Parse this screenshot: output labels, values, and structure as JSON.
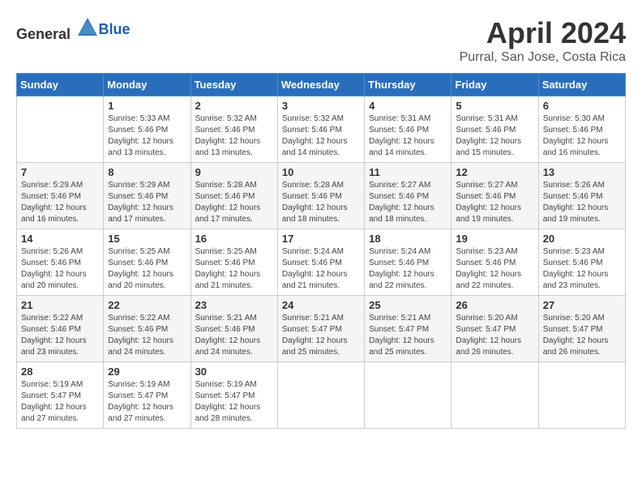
{
  "header": {
    "logo_general": "General",
    "logo_blue": "Blue",
    "title": "April 2024",
    "location": "Purral, San Jose, Costa Rica"
  },
  "calendar": {
    "days_of_week": [
      "Sunday",
      "Monday",
      "Tuesday",
      "Wednesday",
      "Thursday",
      "Friday",
      "Saturday"
    ],
    "weeks": [
      [
        {
          "day": "",
          "sunrise": "",
          "sunset": "",
          "daylight": ""
        },
        {
          "day": "1",
          "sunrise": "Sunrise: 5:33 AM",
          "sunset": "Sunset: 5:46 PM",
          "daylight": "Daylight: 12 hours and 13 minutes."
        },
        {
          "day": "2",
          "sunrise": "Sunrise: 5:32 AM",
          "sunset": "Sunset: 5:46 PM",
          "daylight": "Daylight: 12 hours and 13 minutes."
        },
        {
          "day": "3",
          "sunrise": "Sunrise: 5:32 AM",
          "sunset": "Sunset: 5:46 PM",
          "daylight": "Daylight: 12 hours and 14 minutes."
        },
        {
          "day": "4",
          "sunrise": "Sunrise: 5:31 AM",
          "sunset": "Sunset: 5:46 PM",
          "daylight": "Daylight: 12 hours and 14 minutes."
        },
        {
          "day": "5",
          "sunrise": "Sunrise: 5:31 AM",
          "sunset": "Sunset: 5:46 PM",
          "daylight": "Daylight: 12 hours and 15 minutes."
        },
        {
          "day": "6",
          "sunrise": "Sunrise: 5:30 AM",
          "sunset": "Sunset: 5:46 PM",
          "daylight": "Daylight: 12 hours and 16 minutes."
        }
      ],
      [
        {
          "day": "7",
          "sunrise": "Sunrise: 5:29 AM",
          "sunset": "Sunset: 5:46 PM",
          "daylight": "Daylight: 12 hours and 16 minutes."
        },
        {
          "day": "8",
          "sunrise": "Sunrise: 5:29 AM",
          "sunset": "Sunset: 5:46 PM",
          "daylight": "Daylight: 12 hours and 17 minutes."
        },
        {
          "day": "9",
          "sunrise": "Sunrise: 5:28 AM",
          "sunset": "Sunset: 5:46 PM",
          "daylight": "Daylight: 12 hours and 17 minutes."
        },
        {
          "day": "10",
          "sunrise": "Sunrise: 5:28 AM",
          "sunset": "Sunset: 5:46 PM",
          "daylight": "Daylight: 12 hours and 18 minutes."
        },
        {
          "day": "11",
          "sunrise": "Sunrise: 5:27 AM",
          "sunset": "Sunset: 5:46 PM",
          "daylight": "Daylight: 12 hours and 18 minutes."
        },
        {
          "day": "12",
          "sunrise": "Sunrise: 5:27 AM",
          "sunset": "Sunset: 5:46 PM",
          "daylight": "Daylight: 12 hours and 19 minutes."
        },
        {
          "day": "13",
          "sunrise": "Sunrise: 5:26 AM",
          "sunset": "Sunset: 5:46 PM",
          "daylight": "Daylight: 12 hours and 19 minutes."
        }
      ],
      [
        {
          "day": "14",
          "sunrise": "Sunrise: 5:26 AM",
          "sunset": "Sunset: 5:46 PM",
          "daylight": "Daylight: 12 hours and 20 minutes."
        },
        {
          "day": "15",
          "sunrise": "Sunrise: 5:25 AM",
          "sunset": "Sunset: 5:46 PM",
          "daylight": "Daylight: 12 hours and 20 minutes."
        },
        {
          "day": "16",
          "sunrise": "Sunrise: 5:25 AM",
          "sunset": "Sunset: 5:46 PM",
          "daylight": "Daylight: 12 hours and 21 minutes."
        },
        {
          "day": "17",
          "sunrise": "Sunrise: 5:24 AM",
          "sunset": "Sunset: 5:46 PM",
          "daylight": "Daylight: 12 hours and 21 minutes."
        },
        {
          "day": "18",
          "sunrise": "Sunrise: 5:24 AM",
          "sunset": "Sunset: 5:46 PM",
          "daylight": "Daylight: 12 hours and 22 minutes."
        },
        {
          "day": "19",
          "sunrise": "Sunrise: 5:23 AM",
          "sunset": "Sunset: 5:46 PM",
          "daylight": "Daylight: 12 hours and 22 minutes."
        },
        {
          "day": "20",
          "sunrise": "Sunrise: 5:23 AM",
          "sunset": "Sunset: 5:46 PM",
          "daylight": "Daylight: 12 hours and 23 minutes."
        }
      ],
      [
        {
          "day": "21",
          "sunrise": "Sunrise: 5:22 AM",
          "sunset": "Sunset: 5:46 PM",
          "daylight": "Daylight: 12 hours and 23 minutes."
        },
        {
          "day": "22",
          "sunrise": "Sunrise: 5:22 AM",
          "sunset": "Sunset: 5:46 PM",
          "daylight": "Daylight: 12 hours and 24 minutes."
        },
        {
          "day": "23",
          "sunrise": "Sunrise: 5:21 AM",
          "sunset": "Sunset: 5:46 PM",
          "daylight": "Daylight: 12 hours and 24 minutes."
        },
        {
          "day": "24",
          "sunrise": "Sunrise: 5:21 AM",
          "sunset": "Sunset: 5:47 PM",
          "daylight": "Daylight: 12 hours and 25 minutes."
        },
        {
          "day": "25",
          "sunrise": "Sunrise: 5:21 AM",
          "sunset": "Sunset: 5:47 PM",
          "daylight": "Daylight: 12 hours and 25 minutes."
        },
        {
          "day": "26",
          "sunrise": "Sunrise: 5:20 AM",
          "sunset": "Sunset: 5:47 PM",
          "daylight": "Daylight: 12 hours and 26 minutes."
        },
        {
          "day": "27",
          "sunrise": "Sunrise: 5:20 AM",
          "sunset": "Sunset: 5:47 PM",
          "daylight": "Daylight: 12 hours and 26 minutes."
        }
      ],
      [
        {
          "day": "28",
          "sunrise": "Sunrise: 5:19 AM",
          "sunset": "Sunset: 5:47 PM",
          "daylight": "Daylight: 12 hours and 27 minutes."
        },
        {
          "day": "29",
          "sunrise": "Sunrise: 5:19 AM",
          "sunset": "Sunset: 5:47 PM",
          "daylight": "Daylight: 12 hours and 27 minutes."
        },
        {
          "day": "30",
          "sunrise": "Sunrise: 5:19 AM",
          "sunset": "Sunset: 5:47 PM",
          "daylight": "Daylight: 12 hours and 28 minutes."
        },
        {
          "day": "",
          "sunrise": "",
          "sunset": "",
          "daylight": ""
        },
        {
          "day": "",
          "sunrise": "",
          "sunset": "",
          "daylight": ""
        },
        {
          "day": "",
          "sunrise": "",
          "sunset": "",
          "daylight": ""
        },
        {
          "day": "",
          "sunrise": "",
          "sunset": "",
          "daylight": ""
        }
      ]
    ]
  }
}
